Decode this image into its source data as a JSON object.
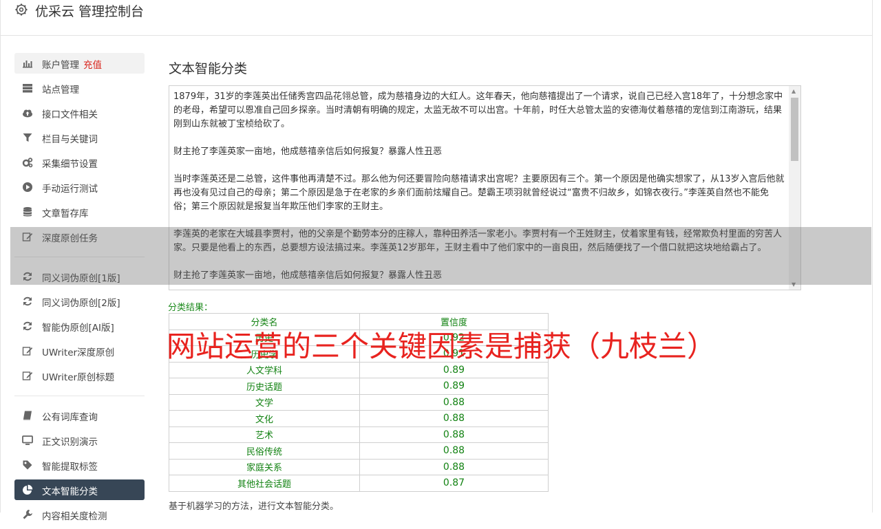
{
  "header": {
    "title": "优采云 管理控制台",
    "icon": "gear-icon"
  },
  "sidebar": {
    "groups": [
      [
        {
          "label": "账户管理",
          "extra": "充值",
          "icon": "bar-chart-icon"
        },
        {
          "label": "站点管理",
          "icon": "server-icon"
        },
        {
          "label": "接口文件相关",
          "icon": "cloud-upload-icon"
        },
        {
          "label": "栏目与关键词",
          "icon": "filter-icon"
        },
        {
          "label": "采集细节设置",
          "icon": "gears-icon"
        },
        {
          "label": "手动运行测试",
          "icon": "play-icon"
        },
        {
          "label": "文章暂存库",
          "icon": "database-icon"
        },
        {
          "label": "深度原创任务",
          "icon": "edit-icon"
        }
      ],
      [
        {
          "label": "同义词伪原创[1版]",
          "icon": "refresh-icon"
        },
        {
          "label": "同义词伪原创[2版]",
          "icon": "refresh-icon"
        },
        {
          "label": "智能伪原创[AI版]",
          "icon": "refresh-icon"
        },
        {
          "label": "UWriter深度原创",
          "icon": "edit-icon"
        },
        {
          "label": "UWriter原创标题",
          "icon": "edit-icon"
        }
      ],
      [
        {
          "label": "公有词库查询",
          "icon": "book-icon"
        },
        {
          "label": "正文识别演示",
          "icon": "desktop-icon"
        },
        {
          "label": "智能提取标签",
          "icon": "tag-icon"
        },
        {
          "label": "文本智能分类",
          "icon": "pie-chart-icon"
        },
        {
          "label": "内容相关度检测",
          "icon": "wrench-icon"
        }
      ]
    ],
    "active_label": "文本智能分类"
  },
  "main": {
    "title": "文本智能分类",
    "text_paragraphs": [
      "1879年，31岁的李莲英出任储秀宫四品花翎总管，成为慈禧身边的大红人。这年春天，他向慈禧提出了一个请求，说自己已经入宫18年了，十分想念家中的老母，希望可以恩准自己回乡探亲。当时清朝有明确的规定，太监无故不可以出宫。十年前，时任大总管太监的安德海仗着慈禧的宠信到江南游玩，结果刚到山东就被丁宝桢给砍了。",
      "财主抢了李莲英家一亩地，他成慈禧亲信后如何报复？暴露人性丑恶",
      "当时李莲英还是二总管，这件事他再清楚不过。那么他为何还要冒险向慈禧请求出宫呢？主要原因有三个。第一个原因是他确实想家了，从13岁入宫后他就再也没有见过自己的母亲；第二个原因是急于在老家的乡亲们面前炫耀自己。楚霸王项羽就曾经说过“富贵不归故乡，如锦衣夜行。”李莲英自然也不能免俗；第三个原因就是报复当年欺压他们李家的王财主。",
      "李莲英的老家在大城县李贾村，他的父亲是个勤劳本分的庄稼人，靠种田养活一家老小。李贾村有一个王姓财主，仗着家里有钱，经常欺负村里面的穷苦人家。只要是他看上的东西，总要想方设法搞过来。李莲英12岁那年，王财主看中了他们家中的一亩良田，然后随便找了一个借口就把这块地给霸占了。",
      "财主抢了李莲英家一亩地，他成慈禧亲信后如何报复？暴露人性丑恶"
    ],
    "result_label": "分类结果：",
    "table": {
      "headers": [
        "分类名",
        "置信度"
      ],
      "rows": [
        [
          "历史",
          "0.92"
        ],
        [
          "历史学",
          "0.91"
        ],
        [
          "人文学科",
          "0.89"
        ],
        [
          "历史话题",
          "0.89"
        ],
        [
          "文学",
          "0.88"
        ],
        [
          "文化",
          "0.88"
        ],
        [
          "艺术",
          "0.88"
        ],
        [
          "民俗传统",
          "0.88"
        ],
        [
          "家庭关系",
          "0.88"
        ],
        [
          "其他社会话题",
          "0.87"
        ]
      ]
    },
    "banner": "网站运营的三个关键因素是捕获（九枝兰）",
    "footnote": "基于机器学习的方法，进行文本智能分类。"
  },
  "colors": {
    "active_nav_bg": "#374656",
    "recharge": "#d9231b",
    "result_green": "#128212",
    "banner_red": "#e8231f"
  }
}
